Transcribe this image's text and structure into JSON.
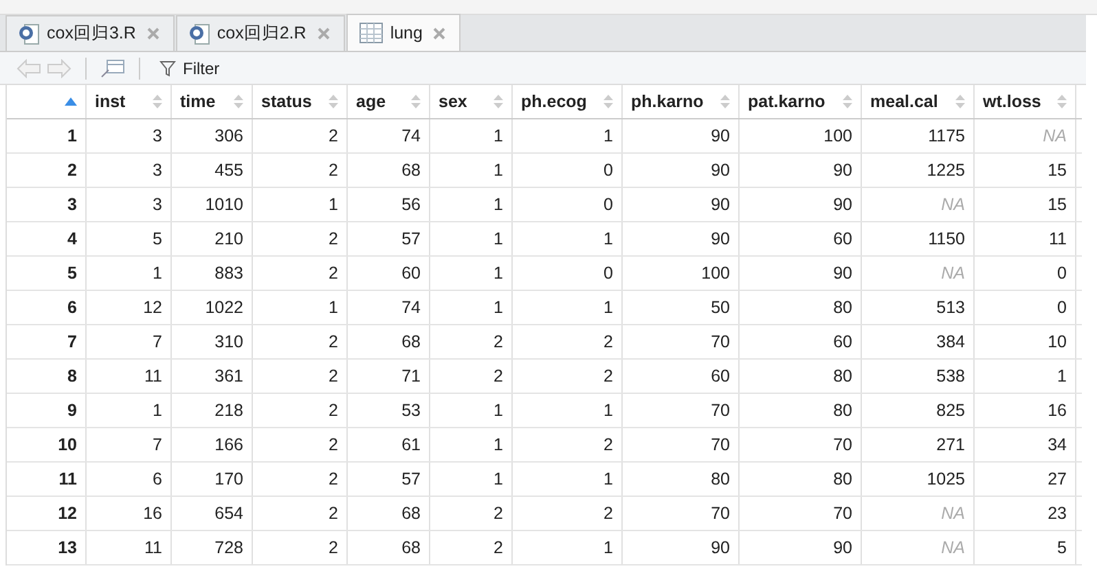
{
  "tabs": [
    {
      "label": "cox回归3.R",
      "kind": "script",
      "selected": false
    },
    {
      "label": "cox回归2.R",
      "kind": "script",
      "selected": false
    },
    {
      "label": "lung",
      "kind": "table",
      "selected": true
    }
  ],
  "toolbar": {
    "filter_label": "Filter"
  },
  "table": {
    "columns": [
      "inst",
      "time",
      "status",
      "age",
      "sex",
      "ph.ecog",
      "ph.karno",
      "pat.karno",
      "meal.cal",
      "wt.loss"
    ],
    "rows": [
      {
        "number": "1",
        "cells": [
          {
            "text": "3",
            "na": false
          },
          {
            "text": "306",
            "na": false
          },
          {
            "text": "2",
            "na": false
          },
          {
            "text": "74",
            "na": false
          },
          {
            "text": "1",
            "na": false
          },
          {
            "text": "1",
            "na": false
          },
          {
            "text": "90",
            "na": false
          },
          {
            "text": "100",
            "na": false
          },
          {
            "text": "1175",
            "na": false
          },
          {
            "text": "NA",
            "na": true
          }
        ]
      },
      {
        "number": "2",
        "cells": [
          {
            "text": "3",
            "na": false
          },
          {
            "text": "455",
            "na": false
          },
          {
            "text": "2",
            "na": false
          },
          {
            "text": "68",
            "na": false
          },
          {
            "text": "1",
            "na": false
          },
          {
            "text": "0",
            "na": false
          },
          {
            "text": "90",
            "na": false
          },
          {
            "text": "90",
            "na": false
          },
          {
            "text": "1225",
            "na": false
          },
          {
            "text": "15",
            "na": false
          }
        ]
      },
      {
        "number": "3",
        "cells": [
          {
            "text": "3",
            "na": false
          },
          {
            "text": "1010",
            "na": false
          },
          {
            "text": "1",
            "na": false
          },
          {
            "text": "56",
            "na": false
          },
          {
            "text": "1",
            "na": false
          },
          {
            "text": "0",
            "na": false
          },
          {
            "text": "90",
            "na": false
          },
          {
            "text": "90",
            "na": false
          },
          {
            "text": "NA",
            "na": true
          },
          {
            "text": "15",
            "na": false
          }
        ]
      },
      {
        "number": "4",
        "cells": [
          {
            "text": "5",
            "na": false
          },
          {
            "text": "210",
            "na": false
          },
          {
            "text": "2",
            "na": false
          },
          {
            "text": "57",
            "na": false
          },
          {
            "text": "1",
            "na": false
          },
          {
            "text": "1",
            "na": false
          },
          {
            "text": "90",
            "na": false
          },
          {
            "text": "60",
            "na": false
          },
          {
            "text": "1150",
            "na": false
          },
          {
            "text": "11",
            "na": false
          }
        ]
      },
      {
        "number": "5",
        "cells": [
          {
            "text": "1",
            "na": false
          },
          {
            "text": "883",
            "na": false
          },
          {
            "text": "2",
            "na": false
          },
          {
            "text": "60",
            "na": false
          },
          {
            "text": "1",
            "na": false
          },
          {
            "text": "0",
            "na": false
          },
          {
            "text": "100",
            "na": false
          },
          {
            "text": "90",
            "na": false
          },
          {
            "text": "NA",
            "na": true
          },
          {
            "text": "0",
            "na": false
          }
        ]
      },
      {
        "number": "6",
        "cells": [
          {
            "text": "12",
            "na": false
          },
          {
            "text": "1022",
            "na": false
          },
          {
            "text": "1",
            "na": false
          },
          {
            "text": "74",
            "na": false
          },
          {
            "text": "1",
            "na": false
          },
          {
            "text": "1",
            "na": false
          },
          {
            "text": "50",
            "na": false
          },
          {
            "text": "80",
            "na": false
          },
          {
            "text": "513",
            "na": false
          },
          {
            "text": "0",
            "na": false
          }
        ]
      },
      {
        "number": "7",
        "cells": [
          {
            "text": "7",
            "na": false
          },
          {
            "text": "310",
            "na": false
          },
          {
            "text": "2",
            "na": false
          },
          {
            "text": "68",
            "na": false
          },
          {
            "text": "2",
            "na": false
          },
          {
            "text": "2",
            "na": false
          },
          {
            "text": "70",
            "na": false
          },
          {
            "text": "60",
            "na": false
          },
          {
            "text": "384",
            "na": false
          },
          {
            "text": "10",
            "na": false
          }
        ]
      },
      {
        "number": "8",
        "cells": [
          {
            "text": "11",
            "na": false
          },
          {
            "text": "361",
            "na": false
          },
          {
            "text": "2",
            "na": false
          },
          {
            "text": "71",
            "na": false
          },
          {
            "text": "2",
            "na": false
          },
          {
            "text": "2",
            "na": false
          },
          {
            "text": "60",
            "na": false
          },
          {
            "text": "80",
            "na": false
          },
          {
            "text": "538",
            "na": false
          },
          {
            "text": "1",
            "na": false
          }
        ]
      },
      {
        "number": "9",
        "cells": [
          {
            "text": "1",
            "na": false
          },
          {
            "text": "218",
            "na": false
          },
          {
            "text": "2",
            "na": false
          },
          {
            "text": "53",
            "na": false
          },
          {
            "text": "1",
            "na": false
          },
          {
            "text": "1",
            "na": false
          },
          {
            "text": "70",
            "na": false
          },
          {
            "text": "80",
            "na": false
          },
          {
            "text": "825",
            "na": false
          },
          {
            "text": "16",
            "na": false
          }
        ]
      },
      {
        "number": "10",
        "cells": [
          {
            "text": "7",
            "na": false
          },
          {
            "text": "166",
            "na": false
          },
          {
            "text": "2",
            "na": false
          },
          {
            "text": "61",
            "na": false
          },
          {
            "text": "1",
            "na": false
          },
          {
            "text": "2",
            "na": false
          },
          {
            "text": "70",
            "na": false
          },
          {
            "text": "70",
            "na": false
          },
          {
            "text": "271",
            "na": false
          },
          {
            "text": "34",
            "na": false
          }
        ]
      },
      {
        "number": "11",
        "cells": [
          {
            "text": "6",
            "na": false
          },
          {
            "text": "170",
            "na": false
          },
          {
            "text": "2",
            "na": false
          },
          {
            "text": "57",
            "na": false
          },
          {
            "text": "1",
            "na": false
          },
          {
            "text": "1",
            "na": false
          },
          {
            "text": "80",
            "na": false
          },
          {
            "text": "80",
            "na": false
          },
          {
            "text": "1025",
            "na": false
          },
          {
            "text": "27",
            "na": false
          }
        ]
      },
      {
        "number": "12",
        "cells": [
          {
            "text": "16",
            "na": false
          },
          {
            "text": "654",
            "na": false
          },
          {
            "text": "2",
            "na": false
          },
          {
            "text": "68",
            "na": false
          },
          {
            "text": "2",
            "na": false
          },
          {
            "text": "2",
            "na": false
          },
          {
            "text": "70",
            "na": false
          },
          {
            "text": "70",
            "na": false
          },
          {
            "text": "NA",
            "na": true
          },
          {
            "text": "23",
            "na": false
          }
        ]
      },
      {
        "number": "13",
        "cells": [
          {
            "text": "11",
            "na": false
          },
          {
            "text": "728",
            "na": false
          },
          {
            "text": "2",
            "na": false
          },
          {
            "text": "68",
            "na": false
          },
          {
            "text": "2",
            "na": false
          },
          {
            "text": "1",
            "na": false
          },
          {
            "text": "90",
            "na": false
          },
          {
            "text": "90",
            "na": false
          },
          {
            "text": "NA",
            "na": true
          },
          {
            "text": "5",
            "na": false
          }
        ]
      }
    ]
  }
}
